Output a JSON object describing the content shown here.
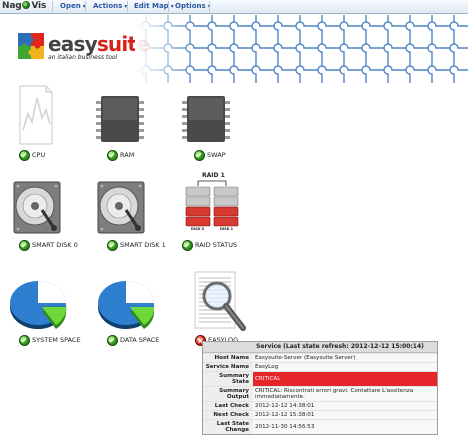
{
  "menubar": {
    "logo": {
      "part1": "Nag",
      "part2": "Vis"
    },
    "items": [
      {
        "label": "Open"
      },
      {
        "label": "Actions"
      },
      {
        "label": "Edit Map"
      },
      {
        "label": "Options"
      }
    ]
  },
  "banner": {
    "brand_part1": "easy",
    "brand_part2": "suite",
    "tagline": "an italian business tool"
  },
  "tiles": {
    "cpu": {
      "label": "CPU",
      "status": "ok"
    },
    "ram": {
      "label": "RAM",
      "status": "ok"
    },
    "swap": {
      "label": "SWAP",
      "status": "ok"
    },
    "smart_disk_0": {
      "label": "SMART DISK 0",
      "status": "ok"
    },
    "smart_disk_1": {
      "label": "SMART DISK 1",
      "status": "ok"
    },
    "raid_status": {
      "label": "RAID STATUS",
      "status": "ok",
      "raid_title": "RAID 1",
      "disk_a": "DISK 0",
      "disk_b": "DISK 1"
    },
    "system_space": {
      "label": "SYSTEM SPACE",
      "status": "ok"
    },
    "data_space": {
      "label": "DATA SPACE",
      "status": "ok"
    },
    "easylog": {
      "label": "EASYLOG",
      "status": "critical"
    }
  },
  "popup": {
    "title": "Service (Last state refresh: 2012-12-12 15:00:14)",
    "rows": [
      {
        "key": "Host Name",
        "value": "Easysuite-Server (Easysuite Server)"
      },
      {
        "key": "Service Name",
        "value": "EasyLog"
      },
      {
        "key": "Summary State",
        "value": "CRITICAL"
      },
      {
        "key": "Summary Output",
        "value": "CRITICAL: Riscontrati errori gravi. Contattare L'assitenza immediatamente."
      },
      {
        "key": "Last Check",
        "value": "2012-12-12 14:38:01"
      },
      {
        "key": "Next Check",
        "value": "2012-12-12 15:38:01"
      },
      {
        "key": "Last State Change",
        "value": "2012-11-30 14:56:53"
      }
    ]
  },
  "colors": {
    "menu_text": "#2b5aa3",
    "brand_red": "#d6231a",
    "ok_green": "#38a21e",
    "critical_red": "#e8242b"
  }
}
